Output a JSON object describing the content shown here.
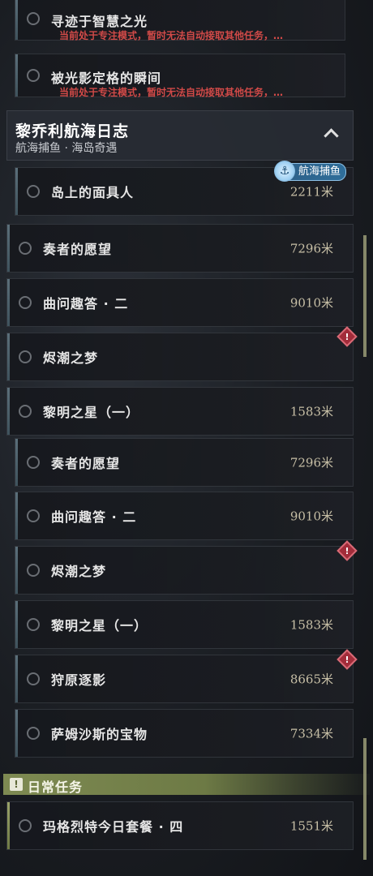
{
  "warn_tasks": [
    {
      "title": "寻迹于智慧之光",
      "subtitle": "当前处于专注模式，暂时无法自动接取其他任务，…"
    },
    {
      "title": "被光影定格的瞬间",
      "subtitle": "当前处于专注模式，暂时无法自动接取其他任务，…"
    }
  ],
  "section": {
    "title": "黎乔利航海日志",
    "subtitle": "航海捕鱼 · 海岛奇遇"
  },
  "tag": {
    "label": "航海捕鱼",
    "icon": "anchor-icon"
  },
  "tasks_top": [
    {
      "title": "岛上的面具人",
      "distance": "2211米"
    },
    {
      "title": "奏者的愿望",
      "distance": "7296米"
    },
    {
      "title": "曲问趣答 · 二",
      "distance": "9010米"
    },
    {
      "title": "烬潮之梦",
      "distance": ""
    },
    {
      "title": "黎明之星（一）",
      "distance": "1583米"
    }
  ],
  "tasks_bottom": [
    {
      "title": "奏者的愿望",
      "distance": "7296米"
    },
    {
      "title": "曲问趣答 · 二",
      "distance": "9010米"
    },
    {
      "title": "烬潮之梦",
      "distance": ""
    },
    {
      "title": "黎明之星（一）",
      "distance": "1583米"
    },
    {
      "title": "狩原逐影",
      "distance": "8665米"
    },
    {
      "title": "萨姆沙斯的宝物",
      "distance": "7334米"
    }
  ],
  "daily": {
    "label": "日常任务",
    "task": {
      "title": "玛格烈特今日套餐 · 四",
      "distance": "1551米"
    }
  },
  "alert_glyph": "!",
  "colors": {
    "warning_red": "#d14a48",
    "daily_green": "#7e8a52",
    "tag_blue": "#2f6e9a"
  }
}
